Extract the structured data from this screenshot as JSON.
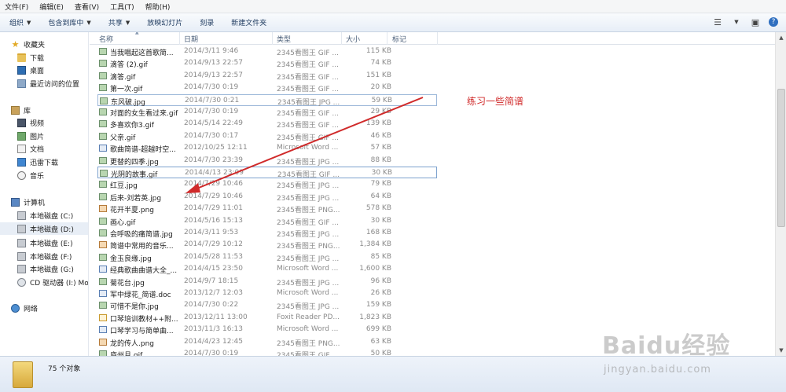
{
  "menubar": [
    "文件(F)",
    "编辑(E)",
    "查看(V)",
    "工具(T)",
    "帮助(H)"
  ],
  "toolbar": {
    "organize": "组织",
    "include_library": "包含到库中",
    "share": "共享",
    "slideshow": "放映幻灯片",
    "burn": "刻录",
    "new_folder": "新建文件夹"
  },
  "nav": {
    "favorites": "收藏夹",
    "downloads": "下载",
    "desktop": "桌面",
    "recent": "最近访问的位置",
    "libraries": "库",
    "videos": "视频",
    "pictures": "图片",
    "documents": "文档",
    "xunlei": "迅雷下载",
    "music": "音乐",
    "computer": "计算机",
    "disk_c": "本地磁盘 (C:)",
    "disk_d": "本地磁盘 (D:)",
    "disk_e": "本地磁盘 (E:)",
    "disk_f": "本地磁盘 (F:)",
    "disk_g": "本地磁盘 (G:)",
    "cd_drive": "CD 驱动器 (I:) Mo",
    "network": "网络"
  },
  "columns": {
    "name": "名称",
    "date": "日期",
    "type": "类型",
    "size": "大小",
    "tags": "标记"
  },
  "files": [
    {
      "name": "当我唱起这首歌简...",
      "date": "2014/3/11 9:46",
      "type": "2345看图王 GIF ...",
      "size": "115 KB",
      "kind": "gif"
    },
    {
      "name": "滴答 (2).gif",
      "date": "2014/9/13 22:57",
      "type": "2345看图王 GIF ...",
      "size": "74 KB",
      "kind": "gif"
    },
    {
      "name": "滴答.gif",
      "date": "2014/9/13 22:57",
      "type": "2345看图王 GIF ...",
      "size": "151 KB",
      "kind": "gif"
    },
    {
      "name": "第一次.gif",
      "date": "2014/7/30 0:19",
      "type": "2345看图王 GIF ...",
      "size": "20 KB",
      "kind": "gif"
    },
    {
      "name": "东风破.jpg",
      "date": "2014/7/30 0:21",
      "type": "2345看图王 JPG ...",
      "size": "59 KB",
      "kind": "jpg"
    },
    {
      "name": "对面的女生看过来.gif",
      "date": "2014/7/30 0:19",
      "type": "2345看图王 GIF ...",
      "size": "29 KB",
      "kind": "gif"
    },
    {
      "name": "多喜欢你3.gif",
      "date": "2014/5/14 22:49",
      "type": "2345看图王 GIF ...",
      "size": "139 KB",
      "kind": "gif"
    },
    {
      "name": "父亲.gif",
      "date": "2014/7/30 0:17",
      "type": "2345看图王 GIF ...",
      "size": "46 KB",
      "kind": "gif"
    },
    {
      "name": "歌曲简谱-超越时空...",
      "date": "2012/10/25 12:11",
      "type": "Microsoft Word ...",
      "size": "57 KB",
      "kind": "doc"
    },
    {
      "name": "更替的四季.jpg",
      "date": "2014/7/30 23:39",
      "type": "2345看图王 JPG ...",
      "size": "88 KB",
      "kind": "jpg"
    },
    {
      "name": "光阴的故事.gif",
      "date": "2014/4/13 23:09",
      "type": "2345看图王 GIF ...",
      "size": "30 KB",
      "kind": "gif"
    },
    {
      "name": "红豆.jpg",
      "date": "2014/7/29 10:46",
      "type": "2345看图王 JPG ...",
      "size": "79 KB",
      "kind": "jpg"
    },
    {
      "name": "后来-刘若英.jpg",
      "date": "2014/7/29 10:46",
      "type": "2345看图王 JPG ...",
      "size": "64 KB",
      "kind": "jpg"
    },
    {
      "name": "花开半夏.png",
      "date": "2014/7/29 11:01",
      "type": "2345看图王 PNG...",
      "size": "578 KB",
      "kind": "png"
    },
    {
      "name": "画心.gif",
      "date": "2014/5/16 15:13",
      "type": "2345看图王 GIF ...",
      "size": "30 KB",
      "kind": "gif"
    },
    {
      "name": "会呼吸的痛简谱.jpg",
      "date": "2014/3/11 9:53",
      "type": "2345看图王 JPG ...",
      "size": "168 KB",
      "kind": "jpg"
    },
    {
      "name": "简谱中常用的音乐...",
      "date": "2014/7/29 10:12",
      "type": "2345看图王 PNG...",
      "size": "1,384 KB",
      "kind": "png"
    },
    {
      "name": "金玉良缘.jpg",
      "date": "2014/5/28 11:53",
      "type": "2345看图王 JPG ...",
      "size": "85 KB",
      "kind": "jpg"
    },
    {
      "name": "经典歌曲曲谱大全_...",
      "date": "2014/4/15 23:50",
      "type": "Microsoft Word ...",
      "size": "1,600 KB",
      "kind": "doc"
    },
    {
      "name": "菊花台.jpg",
      "date": "2014/9/7 18:15",
      "type": "2345看图王 JPG ...",
      "size": "96 KB",
      "kind": "jpg"
    },
    {
      "name": "军中绿花_简谱.doc",
      "date": "2013/12/7 12:03",
      "type": "Microsoft Word ...",
      "size": "26 KB",
      "kind": "doc"
    },
    {
      "name": "可惜不是你.jpg",
      "date": "2014/7/30 0:22",
      "type": "2345看图王 JPG ...",
      "size": "159 KB",
      "kind": "jpg"
    },
    {
      "name": "口琴培训教材++附...",
      "date": "2013/12/11 13:00",
      "type": "Foxit Reader PD...",
      "size": "1,823 KB",
      "kind": "pdf"
    },
    {
      "name": "口琴学习与简单曲...",
      "date": "2013/11/3 16:13",
      "type": "Microsoft Word ...",
      "size": "699 KB",
      "kind": "doc"
    },
    {
      "name": "龙的传人.png",
      "date": "2014/4/23 12:45",
      "type": "2345看图王 PNG...",
      "size": "63 KB",
      "kind": "png"
    },
    {
      "name": "庐州月.gif",
      "date": "2014/7/30 0:19",
      "type": "2345看图王 GIF ...",
      "size": "50 KB",
      "kind": "gif"
    }
  ],
  "status": {
    "count": "75 个对象"
  },
  "annotation": {
    "text": "练习一些简谱"
  },
  "watermark": {
    "logo": "Baidu经验",
    "url": "jingyan.baidu.com"
  },
  "colors": {
    "annotation": "#d02a2a",
    "selection_border": "#7da2ce"
  }
}
